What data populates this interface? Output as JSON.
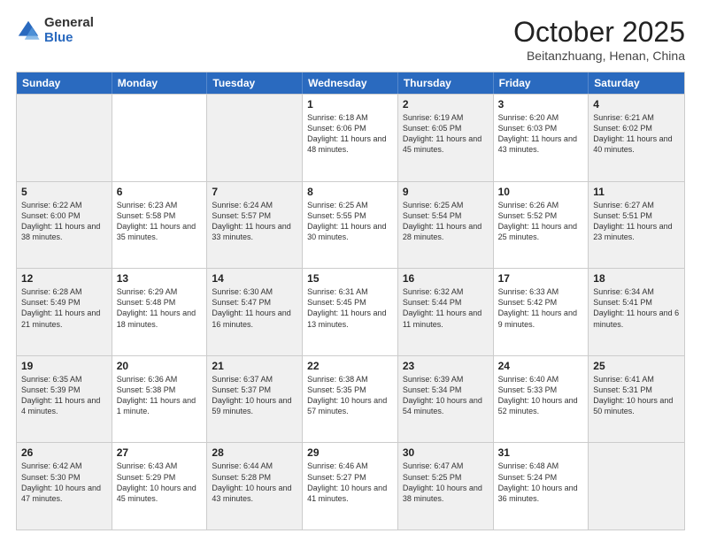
{
  "header": {
    "logo_general": "General",
    "logo_blue": "Blue",
    "month": "October 2025",
    "location": "Beitanzhuang, Henan, China"
  },
  "days_of_week": [
    "Sunday",
    "Monday",
    "Tuesday",
    "Wednesday",
    "Thursday",
    "Friday",
    "Saturday"
  ],
  "rows": [
    [
      {
        "day": "",
        "info": ""
      },
      {
        "day": "",
        "info": ""
      },
      {
        "day": "",
        "info": ""
      },
      {
        "day": "1",
        "info": "Sunrise: 6:18 AM\nSunset: 6:06 PM\nDaylight: 11 hours and 48 minutes."
      },
      {
        "day": "2",
        "info": "Sunrise: 6:19 AM\nSunset: 6:05 PM\nDaylight: 11 hours and 45 minutes."
      },
      {
        "day": "3",
        "info": "Sunrise: 6:20 AM\nSunset: 6:03 PM\nDaylight: 11 hours and 43 minutes."
      },
      {
        "day": "4",
        "info": "Sunrise: 6:21 AM\nSunset: 6:02 PM\nDaylight: 11 hours and 40 minutes."
      }
    ],
    [
      {
        "day": "5",
        "info": "Sunrise: 6:22 AM\nSunset: 6:00 PM\nDaylight: 11 hours and 38 minutes."
      },
      {
        "day": "6",
        "info": "Sunrise: 6:23 AM\nSunset: 5:58 PM\nDaylight: 11 hours and 35 minutes."
      },
      {
        "day": "7",
        "info": "Sunrise: 6:24 AM\nSunset: 5:57 PM\nDaylight: 11 hours and 33 minutes."
      },
      {
        "day": "8",
        "info": "Sunrise: 6:25 AM\nSunset: 5:55 PM\nDaylight: 11 hours and 30 minutes."
      },
      {
        "day": "9",
        "info": "Sunrise: 6:25 AM\nSunset: 5:54 PM\nDaylight: 11 hours and 28 minutes."
      },
      {
        "day": "10",
        "info": "Sunrise: 6:26 AM\nSunset: 5:52 PM\nDaylight: 11 hours and 25 minutes."
      },
      {
        "day": "11",
        "info": "Sunrise: 6:27 AM\nSunset: 5:51 PM\nDaylight: 11 hours and 23 minutes."
      }
    ],
    [
      {
        "day": "12",
        "info": "Sunrise: 6:28 AM\nSunset: 5:49 PM\nDaylight: 11 hours and 21 minutes."
      },
      {
        "day": "13",
        "info": "Sunrise: 6:29 AM\nSunset: 5:48 PM\nDaylight: 11 hours and 18 minutes."
      },
      {
        "day": "14",
        "info": "Sunrise: 6:30 AM\nSunset: 5:47 PM\nDaylight: 11 hours and 16 minutes."
      },
      {
        "day": "15",
        "info": "Sunrise: 6:31 AM\nSunset: 5:45 PM\nDaylight: 11 hours and 13 minutes."
      },
      {
        "day": "16",
        "info": "Sunrise: 6:32 AM\nSunset: 5:44 PM\nDaylight: 11 hours and 11 minutes."
      },
      {
        "day": "17",
        "info": "Sunrise: 6:33 AM\nSunset: 5:42 PM\nDaylight: 11 hours and 9 minutes."
      },
      {
        "day": "18",
        "info": "Sunrise: 6:34 AM\nSunset: 5:41 PM\nDaylight: 11 hours and 6 minutes."
      }
    ],
    [
      {
        "day": "19",
        "info": "Sunrise: 6:35 AM\nSunset: 5:39 PM\nDaylight: 11 hours and 4 minutes."
      },
      {
        "day": "20",
        "info": "Sunrise: 6:36 AM\nSunset: 5:38 PM\nDaylight: 11 hours and 1 minute."
      },
      {
        "day": "21",
        "info": "Sunrise: 6:37 AM\nSunset: 5:37 PM\nDaylight: 10 hours and 59 minutes."
      },
      {
        "day": "22",
        "info": "Sunrise: 6:38 AM\nSunset: 5:35 PM\nDaylight: 10 hours and 57 minutes."
      },
      {
        "day": "23",
        "info": "Sunrise: 6:39 AM\nSunset: 5:34 PM\nDaylight: 10 hours and 54 minutes."
      },
      {
        "day": "24",
        "info": "Sunrise: 6:40 AM\nSunset: 5:33 PM\nDaylight: 10 hours and 52 minutes."
      },
      {
        "day": "25",
        "info": "Sunrise: 6:41 AM\nSunset: 5:31 PM\nDaylight: 10 hours and 50 minutes."
      }
    ],
    [
      {
        "day": "26",
        "info": "Sunrise: 6:42 AM\nSunset: 5:30 PM\nDaylight: 10 hours and 47 minutes."
      },
      {
        "day": "27",
        "info": "Sunrise: 6:43 AM\nSunset: 5:29 PM\nDaylight: 10 hours and 45 minutes."
      },
      {
        "day": "28",
        "info": "Sunrise: 6:44 AM\nSunset: 5:28 PM\nDaylight: 10 hours and 43 minutes."
      },
      {
        "day": "29",
        "info": "Sunrise: 6:46 AM\nSunset: 5:27 PM\nDaylight: 10 hours and 41 minutes."
      },
      {
        "day": "30",
        "info": "Sunrise: 6:47 AM\nSunset: 5:25 PM\nDaylight: 10 hours and 38 minutes."
      },
      {
        "day": "31",
        "info": "Sunrise: 6:48 AM\nSunset: 5:24 PM\nDaylight: 10 hours and 36 minutes."
      },
      {
        "day": "",
        "info": ""
      }
    ]
  ]
}
